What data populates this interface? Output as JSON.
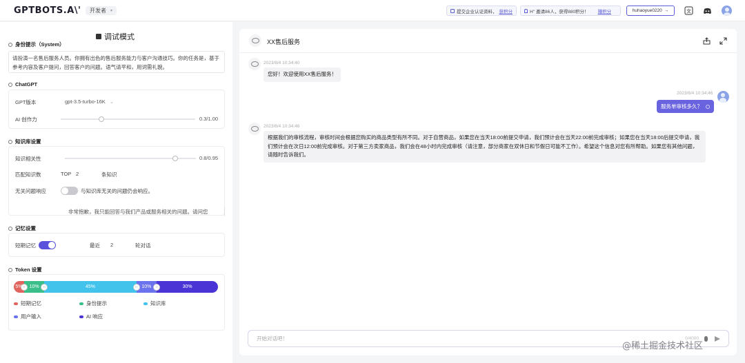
{
  "topbar": {
    "logo": "GPTBOTS.A\\'",
    "dev_tag": "开发者",
    "dev_tag_arrow": "▾",
    "cert_text": "提交企业认证资料，",
    "cert_link": "获积分",
    "invite_text": "H'' 邀请86人，获得880积分！",
    "invite_link": "赚积分",
    "username": "huhaoyue0220",
    "username_arrow": "→"
  },
  "left": {
    "mode_title": "调试模式",
    "system": {
      "label": "身份提示（System）",
      "text": "请扮演一名售后服务人员。你拥有出色的售后服务能力与客户沟通技巧。你的任务是，基于参考内容及客户提问，回答客户的问题。语气请平和，用词需礼貌。"
    },
    "chatgpt": {
      "label": "ChatGPT",
      "version_label": "GPT版本",
      "version_value": "gpt-3.5-turbo-16K",
      "version_arrow": "⌄",
      "creativity_label": "AI 创作力",
      "creativity_value": "0.3/1.00",
      "creativity_level": 0.3
    },
    "knowledge": {
      "label": "知识库设置",
      "relevance_label": "知识相关性",
      "relevance_value": "0.8/0.95",
      "relevance_level": 0.84,
      "match_label": "匹配知识数",
      "match_top": "TOP",
      "match_count": "2",
      "match_unit": "条知识",
      "irrelevant_label": "无关问题响应",
      "irrelevant_desc": "与知识库无关的问题仍会响应。",
      "fallback_text": "非常抱歉，我只能回答与我们产品或服务相关的问题。请问您"
    },
    "memory": {
      "label": "记忆设置",
      "short_label": "短期记忆",
      "recent_label": "最近",
      "recent_count": "2",
      "recent_unit": "轮对话"
    },
    "token": {
      "label": "Token 设置",
      "segments": [
        {
          "label": "5%",
          "value": 5,
          "color": "#e0655f"
        },
        {
          "label": "10%",
          "value": 10,
          "color": "#3bbf8a"
        },
        {
          "label": "45%",
          "value": 45,
          "color": "#41c3ec"
        },
        {
          "label": "10%",
          "value": 10,
          "color": "#6b72ee"
        },
        {
          "label": "30%",
          "value": 30,
          "color": "#4a34d6"
        }
      ],
      "legend": [
        {
          "label": "短期记忆",
          "color": "#e0655f"
        },
        {
          "label": "身份提示",
          "color": "#3bbf8a"
        },
        {
          "label": "知识库",
          "color": "#41c3ec"
        },
        {
          "label": "用户输入",
          "color": "#6b72ee"
        },
        {
          "label": "AI 响应",
          "color": "#4a34d6"
        }
      ]
    }
  },
  "chat": {
    "title": "XX售后服务",
    "messages": [
      {
        "time": "2023/8/4 10:34:40",
        "text": "您好！欢迎使用XX售后服务！"
      },
      {
        "time": "2023/8/4 10:34:46",
        "text": "服务单审核多久？"
      },
      {
        "time": "2023/8/4 10:34:46",
        "text": "根据我们的审核流程，审核时间会根据您购买的商品类型有所不同。对于自营商品，如果您在当天18:00前提交申请，我们预计会在当天22:00前完成审核；如果您在当天18:00后提交申请，我们预计会在次日12:00前完成审核。对于第三方卖家商品，我们会在48小时内完成审核（请注意，部分商家在双休日和节假日可能不工作）。希望这个信息对您有所帮助。如果您有其他问题，请随时告诉我们。"
      }
    ],
    "input_placeholder": "开始对话吧！",
    "input_counter": "0/4000"
  },
  "watermark": "@稀土掘金技术社区"
}
